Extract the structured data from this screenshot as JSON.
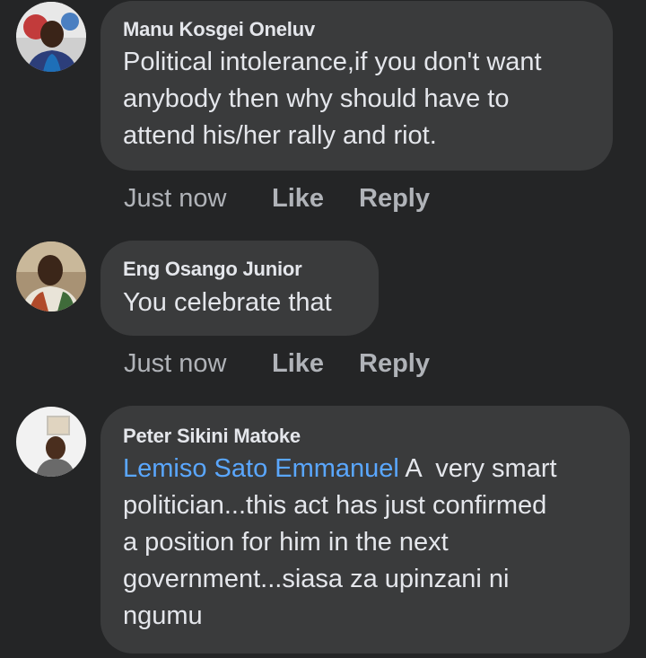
{
  "comments": [
    {
      "author": "Manu Kosgei Oneluv",
      "text_lines": [
        "Political intolerance,if you don't want",
        "anybody then why should have to",
        "attend his/her rally and riot."
      ],
      "time": "Just now",
      "like_label": "Like",
      "reply_label": "Reply"
    },
    {
      "author": "Eng Osango Junior",
      "text_lines": [
        "You celebrate that"
      ],
      "time": "Just now",
      "like_label": "Like",
      "reply_label": "Reply"
    },
    {
      "author": "Peter Sikini Matoke",
      "mention": "Lemiso Sato Emmanuel",
      "text_lines": [
        " A  very smart",
        "politician...this act has just confirmed",
        "a position for him in the next",
        "government...siasa za upinzani ni",
        "ngumu"
      ]
    }
  ],
  "colors": {
    "background": "#242526",
    "bubble": "#3a3b3c",
    "text": "#e4e6eb",
    "secondary_text": "#b0b3b8",
    "mention": "#5aa7ff"
  }
}
